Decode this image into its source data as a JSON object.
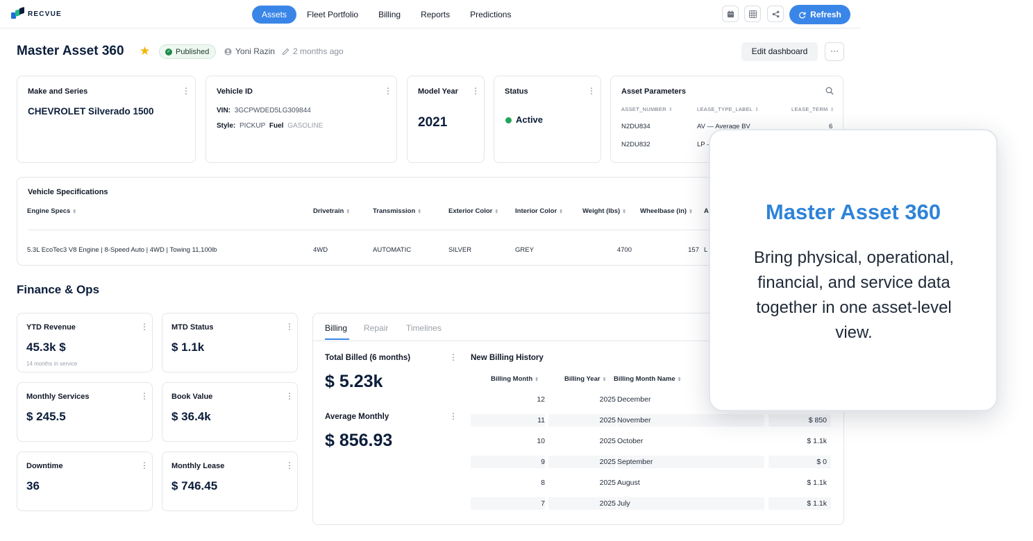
{
  "brand": {
    "name": "RECVUE",
    "accent": "#3a86e8",
    "navy": "#0b1d3a"
  },
  "nav": {
    "items": [
      "Assets",
      "Fleet Portfolio",
      "Billing",
      "Reports",
      "Predictions"
    ],
    "active": "Assets"
  },
  "toolbar": {
    "icons": [
      "calendar-icon",
      "grid-icon",
      "share-icon"
    ],
    "refresh_label": "Refresh"
  },
  "header": {
    "title": "Master Asset 360",
    "status": "Published",
    "owner": "Yoni Razin",
    "updated": "2 months ago",
    "edit_label": "Edit dashboard",
    "more_label": "···"
  },
  "make_series": {
    "title": "Make and Series",
    "value": "CHEVROLET Silverado 1500"
  },
  "vehicle_id": {
    "title": "Vehicle ID",
    "vin_label": "VIN:",
    "vin": "3GCPWDED5LG309844",
    "style_label": "Style:",
    "style": "PICKUP",
    "fuel_label": "Fuel",
    "fuel": "GASOLINE"
  },
  "model_year": {
    "title": "Model Year",
    "value": "2021"
  },
  "status": {
    "title": "Status",
    "value": "Active",
    "color": "#22a55a"
  },
  "asset_parameters": {
    "title": "Asset Parameters",
    "columns": [
      "ASSET_NUMBER",
      "LEASE_TYPE_LABEL",
      "LEASE_TERM"
    ],
    "rows": [
      [
        "N2DU834",
        "AV — Average BV",
        "6"
      ],
      [
        "N2DU832",
        "LP —",
        ""
      ]
    ]
  },
  "vehicle_specs": {
    "title": "Vehicle Specifications",
    "columns": [
      "Engine Specs",
      "Drivetrain",
      "Transmission",
      "Exterior Color",
      "Interior Color",
      "Weight (lbs)",
      "Wheelbase (in)",
      "A"
    ],
    "row": [
      "5.3L EcoTec3 V8 Engine | 8-Speed Auto | 4WD | Towing 11,100lb",
      "4WD",
      "AUTOMATIC",
      "SILVER",
      "GREY",
      "4700",
      "157",
      "L"
    ]
  },
  "finance": {
    "section_title": "Finance & Ops",
    "kpis": [
      {
        "title": "YTD Revenue",
        "value": "45.3k $",
        "note": "14 months in service"
      },
      {
        "title": "MTD Status",
        "value": "$ 1.1k"
      },
      {
        "title": "Monthly Services",
        "value": "$ 245.5"
      },
      {
        "title": "Book Value",
        "value": "$ 36.4k"
      },
      {
        "title": "Downtime",
        "value": "36"
      },
      {
        "title": "Monthly Lease",
        "value": "$ 746.45"
      }
    ]
  },
  "billing_panel": {
    "tabs": [
      "Billing",
      "Repair",
      "Timelines"
    ],
    "active_tab": "Billing",
    "total_billed": {
      "title": "Total Billed (6 months)",
      "value": "$ 5.23k"
    },
    "average_monthly": {
      "title": "Average Monthly",
      "value": "$ 856.93"
    },
    "history": {
      "title": "New Billing History",
      "columns": [
        "Billing Month",
        "Billing Year",
        "Billing Month Name"
      ],
      "rows": [
        {
          "month": "12",
          "year": "2025",
          "name": "December",
          "amount": ""
        },
        {
          "month": "11",
          "year": "2025",
          "name": "November",
          "amount": "$ 850"
        },
        {
          "month": "10",
          "year": "2025",
          "name": "October",
          "amount": "$ 1.1k"
        },
        {
          "month": "9",
          "year": "2025",
          "name": "September",
          "amount": "$ 0"
        },
        {
          "month": "8",
          "year": "2025",
          "name": "August",
          "amount": "$ 1.1k"
        },
        {
          "month": "7",
          "year": "2025",
          "name": "July",
          "amount": "$ 1.1k"
        }
      ]
    }
  },
  "overlay": {
    "title": "Master Asset 360",
    "body": "Bring physical, operational, financial, and service data together in one asset-level view."
  }
}
